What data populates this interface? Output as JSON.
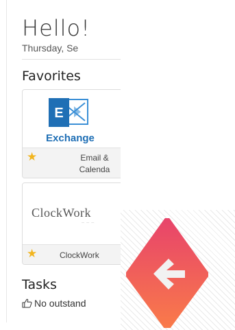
{
  "greeting": "Hello!",
  "date": "Thursday, Se",
  "favorites": {
    "title": "Favorites",
    "tiles": [
      {
        "logo_text": "Exchange",
        "caption_line1": "Email &",
        "caption_line2": "Calenda",
        "brand_color": "#1f6fb5"
      },
      {
        "logo_text": "ClockWork",
        "caption": "ClockWork"
      }
    ]
  },
  "tasks": {
    "title": "Tasks",
    "status": "No outstand"
  },
  "colors": {
    "star": "#f2b51f",
    "back_gradient_top": "#e8456a",
    "back_gradient_bottom": "#f97a4a"
  },
  "icons": {
    "favorite": "star-icon",
    "tasks_status": "thumbs-up-icon",
    "back": "arrow-left-icon"
  }
}
